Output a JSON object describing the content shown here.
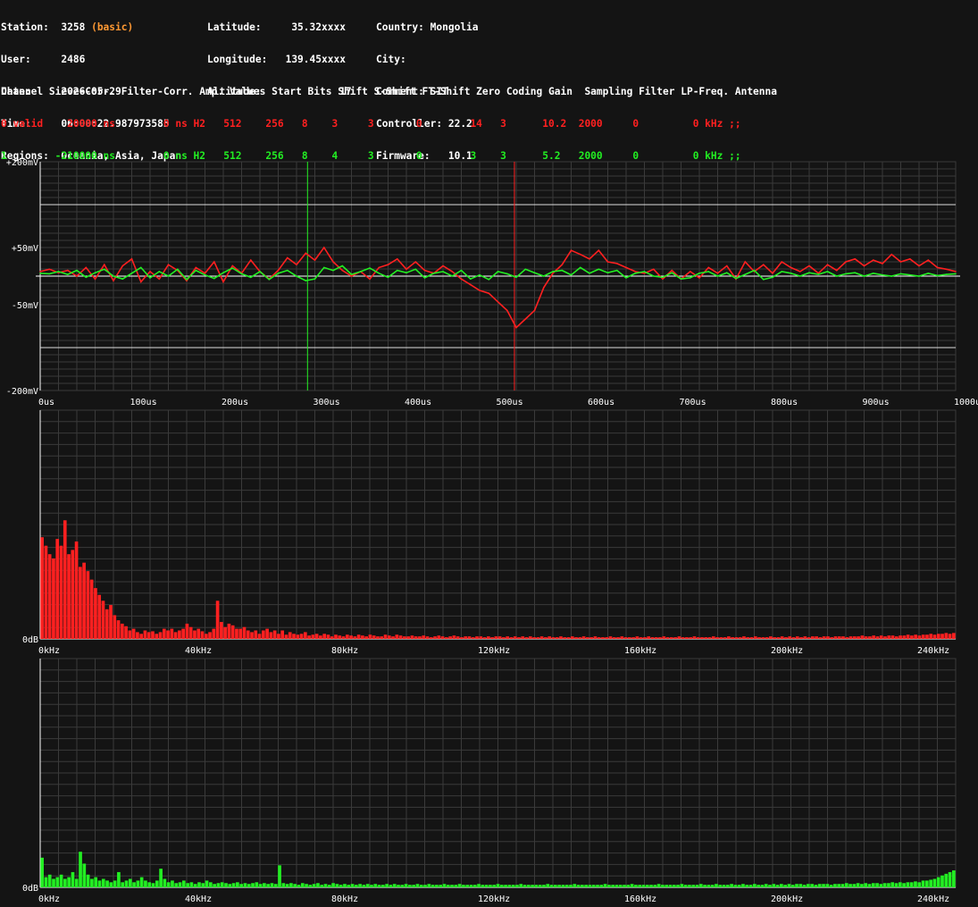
{
  "header": {
    "station_label": "Station:",
    "station_value": "3258",
    "station_badge": "(basic)",
    "user_label": "User:",
    "user_value": "2486",
    "date_label": "Date:",
    "date_value": "2026-05-29",
    "time_label": "Time:",
    "time_value": "06:00:22.987973585",
    "regions_label": "Regions:",
    "regions_value": "Oceania, Asia, Japan",
    "latitude_label": "Latitude:",
    "latitude_value": "35.32xxxx",
    "longitude_label": "Longitude:",
    "longitude_value": "139.45xxxx",
    "altitude_label": "Altitude:",
    "altitude_value": "17",
    "country_label": "Country:",
    "country_value": "Mongolia",
    "city_label": "City:",
    "city_value": "",
    "comment_label": "Comment:",
    "comment_value": "SIT",
    "controller_label": "Controller:",
    "controller_value": "22.2",
    "firmware_label": "Firmware:",
    "firmware_value": "10.1"
  },
  "channel_table": {
    "columns": [
      "Channel",
      "Sieve-Corr.",
      "Filter-Corr.",
      "Amp.",
      "Values",
      "Start",
      "Bits",
      "Shift",
      "S-Shift",
      "FT-Shift",
      "Zero",
      "Coding",
      "Gain",
      "Sampling",
      "Filter",
      "LP-Freq.",
      "Antenna"
    ],
    "rows": [
      {
        "color": "#ff2020",
        "cells": [
          "0 valid",
          "20000 ns",
          "0 ns",
          "H2",
          "512",
          "256",
          "8",
          "3",
          "3",
          "0",
          "14",
          "3",
          "10.2",
          "2000",
          "0",
          "0 kHz",
          ";;"
        ]
      },
      {
        "color": "#22ee22",
        "cells": [
          "1",
          "-210000 ns",
          "0 ns",
          "H2",
          "512",
          "256",
          "8",
          "4",
          "3",
          "0",
          "3",
          "3",
          "5.2",
          "2000",
          "0",
          "0 kHz",
          ";;"
        ]
      }
    ]
  },
  "colors": {
    "background": "#141414",
    "grid": "#3a3a3a",
    "channel0": "#ff2020",
    "channel1": "#22ee22",
    "axis": "#ffffff"
  },
  "chart_data": [
    {
      "type": "line",
      "title": "",
      "xlabel": "",
      "ylabel": "",
      "xlim": [
        0,
        1000
      ],
      "ylim": [
        -200,
        200
      ],
      "x_unit": "us",
      "y_unit": "mV",
      "ytick_labels": [
        "+200mV",
        "+50mV",
        "-50mV",
        "-200mV"
      ],
      "ytick_values": [
        200,
        50,
        -50,
        -200
      ],
      "xtick_labels": [
        "0us",
        "100us",
        "200us",
        "300us",
        "400us",
        "500us",
        "600us",
        "700us",
        "800us",
        "900us",
        "1000us"
      ],
      "xtick_values": [
        0,
        100,
        200,
        300,
        400,
        500,
        600,
        700,
        800,
        900,
        1000
      ],
      "threshold_lines_mV": [
        125,
        -125
      ],
      "markers": [
        {
          "x": 292,
          "color": "#22ee22"
        },
        {
          "x": 518,
          "color": "#ff2020"
        }
      ],
      "series": [
        {
          "color": "#ff2020",
          "x": [
            0,
            10,
            20,
            30,
            40,
            50,
            60,
            70,
            80,
            90,
            100,
            110,
            120,
            130,
            140,
            150,
            160,
            170,
            180,
            190,
            200,
            210,
            220,
            230,
            240,
            250,
            260,
            270,
            280,
            290,
            300,
            310,
            320,
            330,
            340,
            350,
            360,
            370,
            380,
            390,
            400,
            410,
            420,
            430,
            440,
            450,
            460,
            470,
            480,
            490,
            500,
            510,
            520,
            530,
            540,
            550,
            560,
            570,
            580,
            590,
            600,
            610,
            620,
            630,
            640,
            650,
            660,
            670,
            680,
            690,
            700,
            710,
            720,
            730,
            740,
            750,
            760,
            770,
            780,
            790,
            800,
            810,
            820,
            830,
            840,
            850,
            860,
            870,
            880,
            890,
            900,
            910,
            920,
            930,
            940,
            950,
            960,
            970,
            980,
            990,
            1000
          ],
          "y": [
            8,
            12,
            6,
            10,
            0,
            15,
            -5,
            20,
            -8,
            18,
            30,
            -10,
            8,
            -5,
            20,
            10,
            -8,
            15,
            5,
            25,
            -10,
            18,
            5,
            28,
            8,
            -5,
            10,
            32,
            20,
            40,
            28,
            50,
            25,
            10,
            0,
            8,
            -5,
            15,
            20,
            30,
            12,
            25,
            10,
            5,
            18,
            8,
            -5,
            -15,
            -25,
            -30,
            -45,
            -60,
            -90,
            -75,
            -60,
            -20,
            5,
            20,
            45,
            38,
            30,
            45,
            25,
            22,
            15,
            8,
            5,
            12,
            -5,
            10,
            -5,
            8,
            -3,
            15,
            5,
            18,
            -5,
            25,
            8,
            20,
            5,
            25,
            15,
            8,
            18,
            5,
            20,
            10,
            25,
            30,
            18,
            28,
            22,
            38,
            25,
            30,
            18,
            28,
            15,
            12,
            8
          ]
        },
        {
          "color": "#22ee22",
          "x": [
            0,
            10,
            20,
            30,
            40,
            50,
            60,
            70,
            80,
            90,
            100,
            110,
            120,
            130,
            140,
            150,
            160,
            170,
            180,
            190,
            200,
            210,
            220,
            230,
            240,
            250,
            260,
            270,
            280,
            290,
            300,
            310,
            320,
            330,
            340,
            350,
            360,
            370,
            380,
            390,
            400,
            410,
            420,
            430,
            440,
            450,
            460,
            470,
            480,
            490,
            500,
            510,
            520,
            530,
            540,
            550,
            560,
            570,
            580,
            590,
            600,
            610,
            620,
            630,
            640,
            650,
            660,
            670,
            680,
            690,
            700,
            710,
            720,
            730,
            740,
            750,
            760,
            770,
            780,
            790,
            800,
            810,
            820,
            830,
            840,
            850,
            860,
            870,
            880,
            890,
            900,
            910,
            920,
            930,
            940,
            950,
            960,
            970,
            980,
            990,
            1000
          ],
          "y": [
            5,
            4,
            8,
            3,
            10,
            -2,
            6,
            12,
            0,
            -5,
            5,
            15,
            -3,
            8,
            0,
            12,
            -6,
            10,
            2,
            -4,
            6,
            14,
            4,
            -2,
            8,
            -6,
            5,
            10,
            0,
            -8,
            -5,
            15,
            10,
            18,
            3,
            8,
            14,
            5,
            -2,
            10,
            6,
            12,
            -3,
            5,
            8,
            0,
            10,
            -5,
            2,
            -6,
            8,
            4,
            -2,
            12,
            6,
            0,
            8,
            10,
            2,
            15,
            5,
            12,
            6,
            10,
            -3,
            5,
            8,
            0,
            -2,
            6,
            -5,
            -3,
            5,
            8,
            0,
            6,
            -4,
            3,
            10,
            -6,
            -2,
            8,
            5,
            0,
            6,
            3,
            8,
            0,
            4,
            6,
            0,
            5,
            2,
            0,
            4,
            2,
            0,
            5,
            1,
            3,
            4
          ]
        }
      ]
    },
    {
      "type": "bar",
      "title": "",
      "xlabel": "",
      "ylabel": "",
      "xlim": [
        0,
        250
      ],
      "x_unit": "kHz",
      "ytick_labels": [
        "0dB"
      ],
      "xtick_labels": [
        "0kHz",
        "40kHz",
        "80kHz",
        "120kHz",
        "160kHz",
        "200kHz",
        "240kHz"
      ],
      "xtick_values": [
        0,
        40,
        80,
        120,
        160,
        200,
        240
      ],
      "series": [
        {
          "color": "#ff2020",
          "values": [
            120,
            110,
            100,
            95,
            118,
            110,
            140,
            100,
            105,
            115,
            85,
            90,
            80,
            70,
            60,
            52,
            45,
            35,
            40,
            28,
            22,
            18,
            15,
            10,
            12,
            8,
            6,
            10,
            8,
            9,
            6,
            8,
            12,
            10,
            12,
            8,
            10,
            12,
            18,
            14,
            10,
            12,
            9,
            6,
            8,
            12,
            45,
            20,
            14,
            18,
            16,
            12,
            12,
            14,
            10,
            8,
            10,
            6,
            10,
            12,
            8,
            10,
            6,
            10,
            5,
            8,
            6,
            5,
            6,
            8,
            4,
            5,
            6,
            4,
            6,
            5,
            3,
            5,
            4,
            3,
            5,
            4,
            3,
            5,
            4,
            3,
            5,
            4,
            3,
            3,
            5,
            4,
            3,
            5,
            4,
            3,
            3,
            4,
            3,
            3,
            4,
            3,
            2,
            3,
            4,
            3,
            2,
            3,
            4,
            3,
            2,
            3,
            3,
            2,
            3,
            3,
            2,
            3,
            2,
            3,
            3,
            2,
            3,
            2,
            3,
            2,
            3,
            2,
            3,
            2,
            2,
            3,
            2,
            3,
            2,
            2,
            3,
            2,
            2,
            3,
            2,
            2,
            3,
            2,
            2,
            3,
            2,
            2,
            2,
            3,
            2,
            2,
            3,
            2,
            2,
            2,
            3,
            2,
            2,
            3,
            2,
            2,
            2,
            3,
            2,
            2,
            2,
            3,
            2,
            2,
            2,
            3,
            2,
            2,
            2,
            2,
            3,
            2,
            2,
            2,
            3,
            2,
            2,
            2,
            3,
            2,
            2,
            3,
            2,
            2,
            2,
            3,
            2,
            2,
            3,
            2,
            3,
            2,
            3,
            2,
            3,
            2,
            3,
            3,
            2,
            3,
            3,
            2,
            3,
            3,
            3,
            2,
            3,
            3,
            3,
            4,
            3,
            3,
            4,
            3,
            4,
            3,
            4,
            4,
            3,
            4,
            4,
            5,
            4,
            5,
            4,
            5,
            5,
            6,
            5,
            6,
            6,
            7,
            6,
            7
          ]
        }
      ]
    },
    {
      "type": "bar",
      "title": "",
      "xlabel": "",
      "ylabel": "",
      "xlim": [
        0,
        250
      ],
      "x_unit": "kHz",
      "ytick_labels": [
        "0dB"
      ],
      "xtick_labels": [
        "0kHz",
        "40kHz",
        "80kHz",
        "120kHz",
        "160kHz",
        "200kHz",
        "240kHz"
      ],
      "xtick_values": [
        0,
        40,
        80,
        120,
        160,
        200,
        240
      ],
      "series": [
        {
          "color": "#22ee22",
          "values": [
            35,
            12,
            15,
            10,
            12,
            15,
            10,
            12,
            18,
            10,
            42,
            28,
            15,
            10,
            12,
            8,
            10,
            8,
            6,
            8,
            18,
            6,
            8,
            10,
            6,
            8,
            12,
            8,
            6,
            5,
            8,
            22,
            10,
            6,
            8,
            5,
            6,
            8,
            5,
            6,
            4,
            6,
            5,
            8,
            6,
            4,
            5,
            6,
            5,
            4,
            5,
            6,
            4,
            5,
            4,
            5,
            6,
            4,
            5,
            4,
            5,
            4,
            26,
            5,
            4,
            5,
            4,
            3,
            5,
            4,
            3,
            4,
            5,
            3,
            4,
            3,
            5,
            4,
            3,
            4,
            3,
            4,
            3,
            4,
            3,
            4,
            3,
            4,
            3,
            3,
            4,
            3,
            4,
            3,
            3,
            4,
            3,
            3,
            4,
            3,
            3,
            4,
            3,
            3,
            3,
            4,
            3,
            3,
            3,
            4,
            3,
            3,
            3,
            3,
            4,
            3,
            3,
            3,
            3,
            4,
            3,
            3,
            3,
            3,
            3,
            4,
            3,
            3,
            3,
            3,
            3,
            3,
            4,
            3,
            3,
            3,
            3,
            3,
            3,
            4,
            3,
            3,
            3,
            3,
            3,
            3,
            3,
            4,
            3,
            3,
            3,
            3,
            3,
            3,
            4,
            3,
            3,
            3,
            3,
            3,
            3,
            4,
            3,
            3,
            3,
            3,
            3,
            4,
            3,
            3,
            3,
            3,
            4,
            3,
            3,
            3,
            4,
            3,
            3,
            3,
            4,
            3,
            3,
            4,
            3,
            3,
            4,
            3,
            3,
            4,
            3,
            4,
            3,
            4,
            3,
            4,
            3,
            4,
            4,
            3,
            4,
            4,
            3,
            4,
            4,
            4,
            3,
            4,
            4,
            4,
            5,
            4,
            4,
            5,
            4,
            5,
            4,
            5,
            5,
            4,
            5,
            5,
            6,
            5,
            6,
            5,
            6,
            6,
            7,
            6,
            8,
            8,
            9,
            10,
            12,
            14,
            16,
            18,
            20
          ]
        }
      ]
    }
  ]
}
